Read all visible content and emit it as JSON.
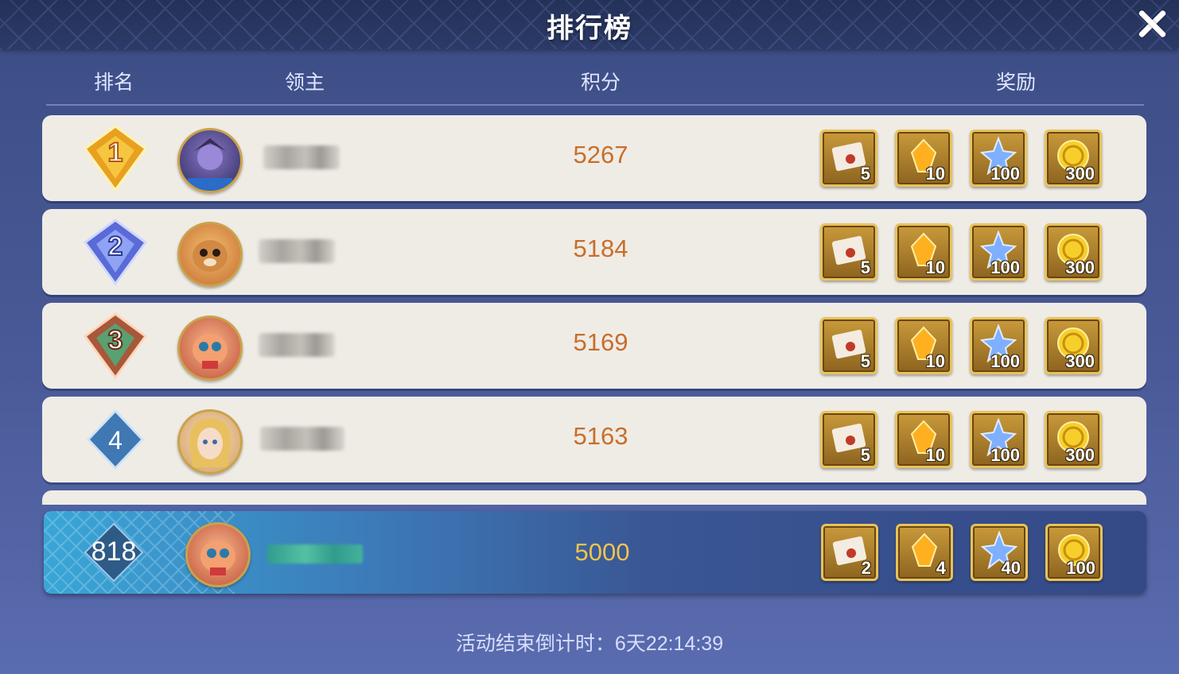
{
  "window": {
    "title": "排行榜",
    "close_icon": "close-icon"
  },
  "columns": {
    "rank": "排名",
    "lord": "领主",
    "score": "积分",
    "reward": "奖励"
  },
  "rows": [
    {
      "rank": "1",
      "badge": "gold-rank-badge",
      "score": "5267",
      "rewards": [
        "5",
        "10",
        "100",
        "300"
      ]
    },
    {
      "rank": "2",
      "badge": "blue-rank-badge",
      "score": "5184",
      "rewards": [
        "5",
        "10",
        "100",
        "300"
      ]
    },
    {
      "rank": "3",
      "badge": "bronze-rank-badge",
      "score": "5169",
      "rewards": [
        "5",
        "10",
        "100",
        "300"
      ]
    },
    {
      "rank": "4",
      "badge": "diamond-rank-badge",
      "score": "5163",
      "rewards": [
        "5",
        "10",
        "100",
        "300"
      ]
    }
  ],
  "self": {
    "rank": "818",
    "score": "5000",
    "rewards": [
      "2",
      "4",
      "40",
      "100"
    ]
  },
  "reward_items": [
    "letter-icon",
    "amber-crystal-icon",
    "star-crystal-icon",
    "gold-coin-icon"
  ],
  "footer": {
    "countdown_label": "活动结束倒计时：",
    "countdown_value": "6天22:14:39"
  },
  "colors": {
    "score": "#c86e2a",
    "row_bg": "#efece6",
    "self_score": "#f2c34c"
  }
}
